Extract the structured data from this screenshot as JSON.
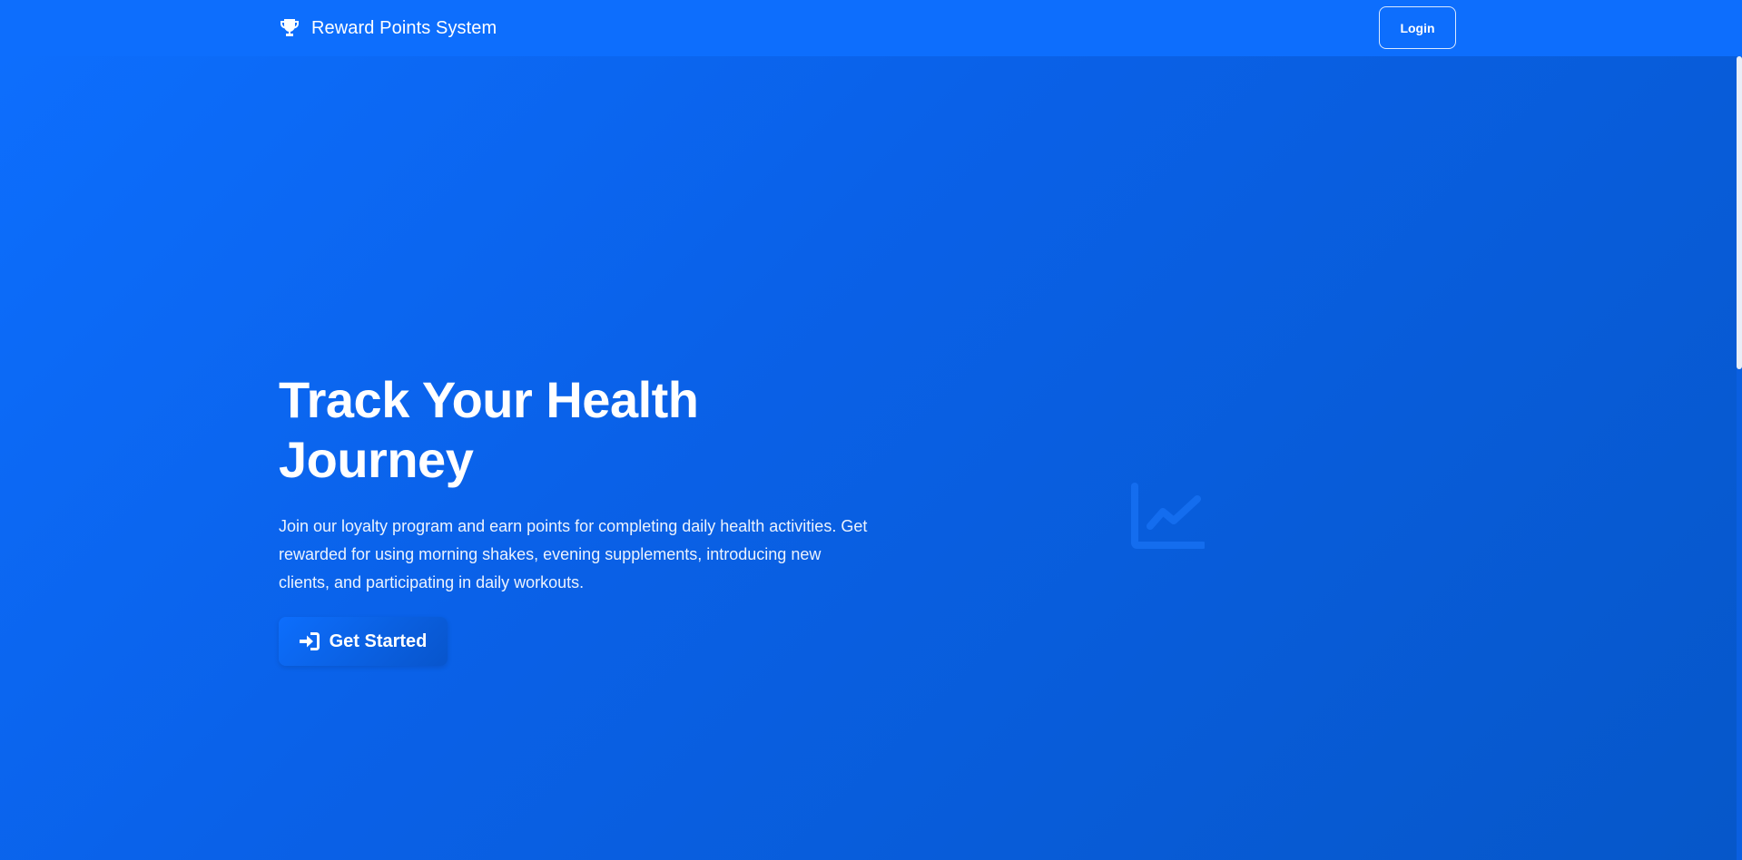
{
  "navbar": {
    "brand_icon": "trophy-icon",
    "brand_text": "Reward Points System",
    "login_label": "Login"
  },
  "hero": {
    "title": "Track Your Health Journey",
    "description": "Join our loyalty program and earn points for completing daily health activities. Get rewarded for using morning shakes, evening supplements, introducing new clients, and participating in daily workouts.",
    "cta_icon": "sign-in-icon",
    "cta_label": "Get Started",
    "illustration_icon": "chart-line-icon"
  },
  "colors": {
    "primary": "#0d6efd",
    "gradient_end": "#0657c9",
    "text": "#ffffff"
  }
}
